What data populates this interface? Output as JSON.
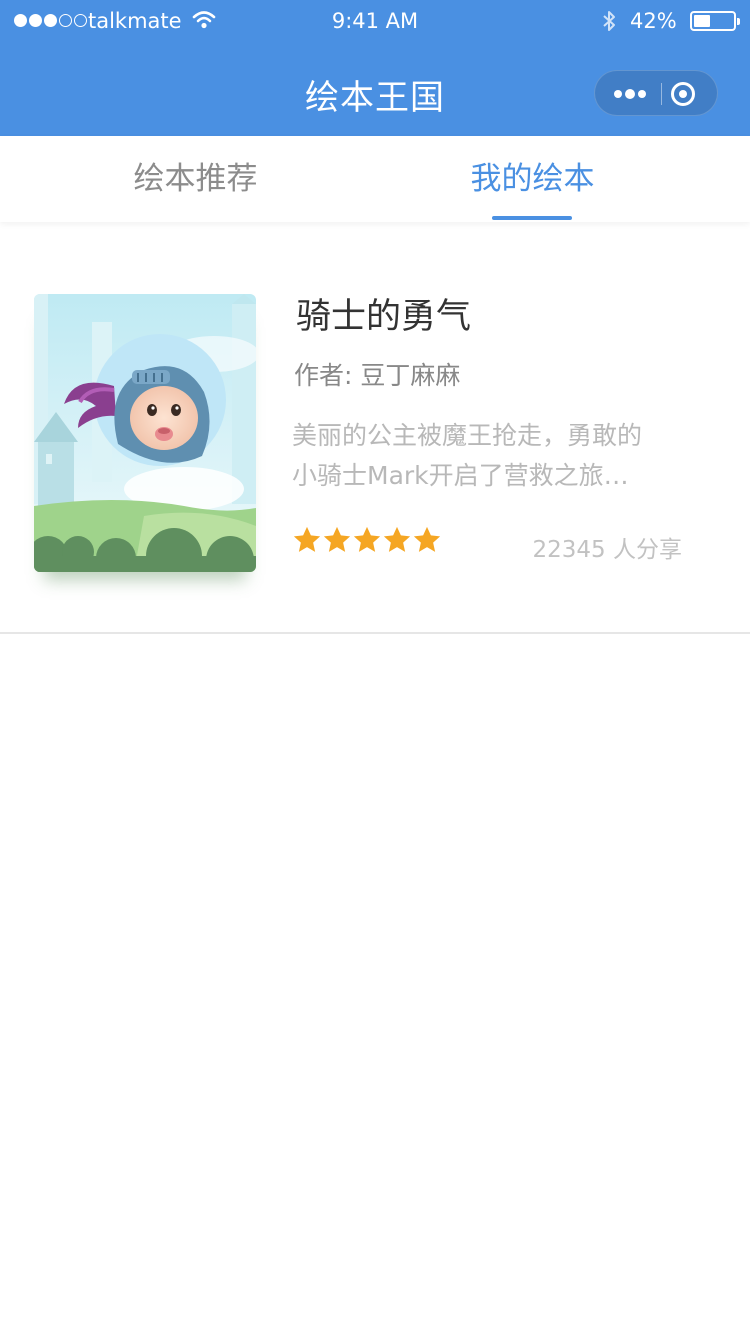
{
  "status_bar": {
    "carrier": "talkmate",
    "time": "9:41 AM",
    "battery_percent": "42%",
    "battery_level": 0.42,
    "signal_bars": 3,
    "signal_total": 5
  },
  "nav": {
    "title": "绘本王国",
    "more_icon": "more-dots-icon",
    "close_icon": "target-close-icon"
  },
  "tabs": [
    {
      "label": "绘本推荐",
      "active": false
    },
    {
      "label": "我的绘本",
      "active": true
    }
  ],
  "book": {
    "title": "骑士的勇气",
    "author": "作者: 豆丁麻麻",
    "description_lines": [
      "美丽的公主被魔王抢走，勇敢的",
      "小骑士Mark开启了营救之旅…"
    ],
    "rating": 5,
    "rating_max": 5,
    "shares": "22345 人分享",
    "cover_icon": "knight-baby-cover-illustration"
  },
  "colors": {
    "primary": "#4a90e2",
    "star": "#f5a623",
    "text_dark": "#333333",
    "text_muted": "#888888",
    "text_light": "#b8b8b8"
  }
}
